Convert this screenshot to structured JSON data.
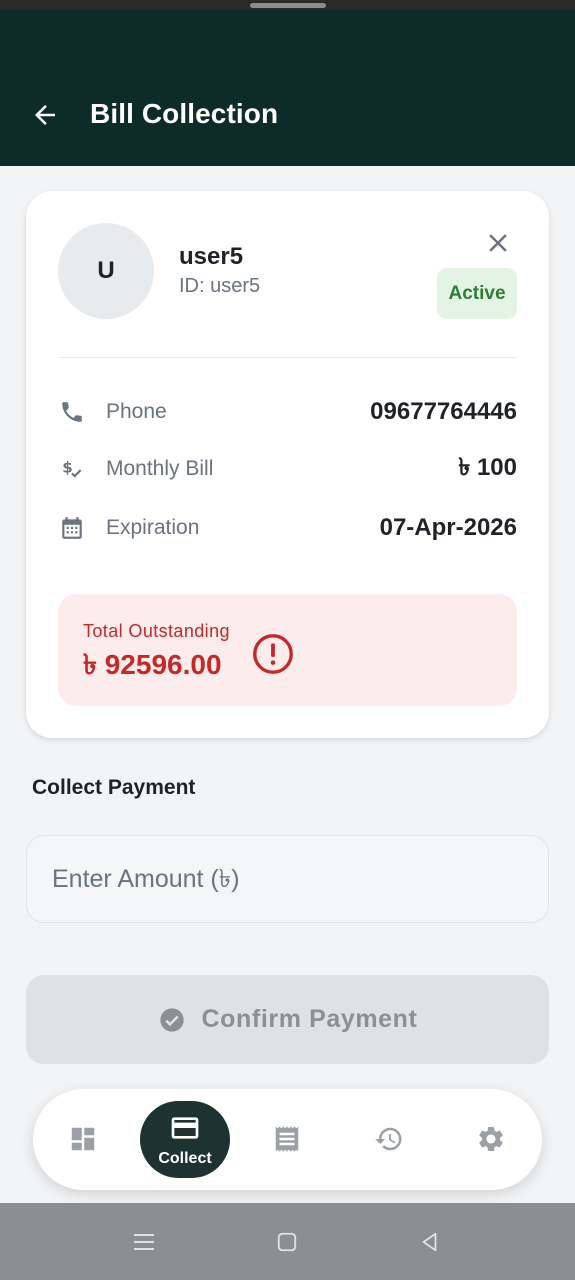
{
  "app_bar": {
    "title": "Bill Collection"
  },
  "customer": {
    "avatar_initial": "U",
    "name": "user5",
    "id_text": "ID: user5",
    "status": "Active",
    "details": [
      {
        "icon": "phone-icon",
        "label": "Phone",
        "value": "09677764446"
      },
      {
        "icon": "monthly-bill-icon",
        "label": "Monthly Bill",
        "value": "৳ 100"
      },
      {
        "icon": "calendar-icon",
        "label": "Expiration",
        "value": "07-Apr-2026"
      }
    ],
    "outstanding": {
      "label": "Total Outstanding",
      "amount": "৳ 92596.00"
    }
  },
  "collect": {
    "section_title": "Collect Payment",
    "amount_placeholder": "Enter Amount (৳)",
    "amount_value": "",
    "confirm_label": "Confirm Payment"
  },
  "bottom_nav": {
    "items": [
      {
        "icon": "dashboard-icon",
        "active": false
      },
      {
        "icon": "card-icon",
        "label": "Collect",
        "active": true
      },
      {
        "icon": "receipt-icon",
        "active": false
      },
      {
        "icon": "history-icon",
        "active": false
      },
      {
        "icon": "settings-icon",
        "active": false
      }
    ]
  },
  "colors": {
    "header": "#0d2b28",
    "status_active_bg": "#e3f4e4",
    "status_active_text": "#2e7d32",
    "outstanding_bg": "#fdecec",
    "outstanding_text": "#c62828",
    "nav_active": "#1e3331"
  }
}
